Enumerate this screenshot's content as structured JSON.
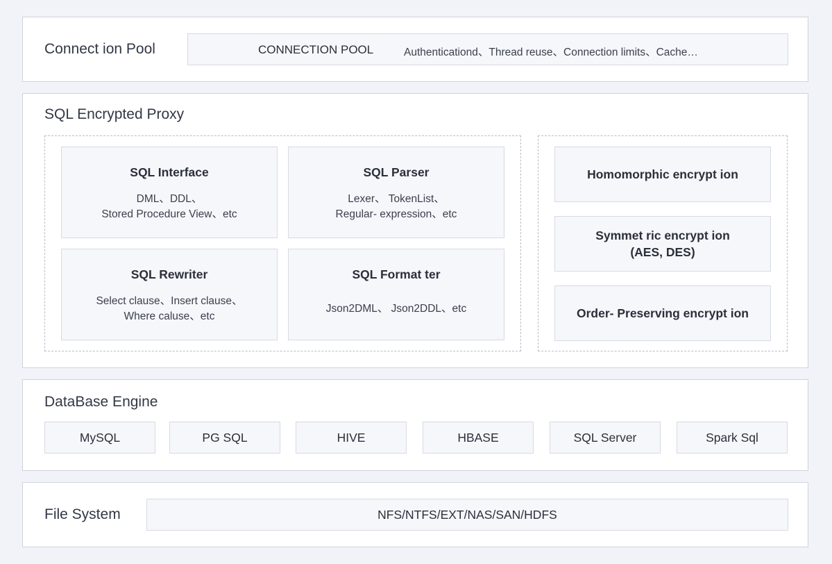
{
  "connection_pool": {
    "title": "Connect ion Pool",
    "bar_name": "CONNECTION POOL",
    "bar_desc": "Authenticationd、Thread reuse、Connection limits、Cache…"
  },
  "proxy": {
    "title": "SQL Encrypted Proxy",
    "modules": [
      {
        "title": "SQL Interface",
        "desc_line1": "DML、DDL、",
        "desc_line2": "Stored Procedure View、etc"
      },
      {
        "title": "SQL Parser",
        "desc_line1": "Lexer、 TokenList、",
        "desc_line2": "Regular- expression、etc"
      },
      {
        "title": "SQL Rewriter",
        "desc_line1": "Select clause、Insert clause、",
        "desc_line2": "Where caluse、etc"
      },
      {
        "title": "SQL Format ter",
        "desc_line1": "Json2DML、 Json2DDL、etc",
        "desc_line2": ""
      }
    ],
    "encryption": [
      {
        "line1": "Homomorphic encrypt ion",
        "line2": ""
      },
      {
        "line1": "Symmet ric encrypt ion",
        "line2": "(AES, DES)"
      },
      {
        "line1": "Order- Preserving encrypt ion",
        "line2": ""
      }
    ]
  },
  "database_engine": {
    "title": "DataBase Engine",
    "engines": [
      "MySQL",
      "PG SQL",
      "HIVE",
      "HBASE",
      "SQL Server",
      "Spark Sql"
    ]
  },
  "file_system": {
    "title": "File System",
    "value": "NFS/NTFS/EXT/NAS/SAN/HDFS"
  }
}
